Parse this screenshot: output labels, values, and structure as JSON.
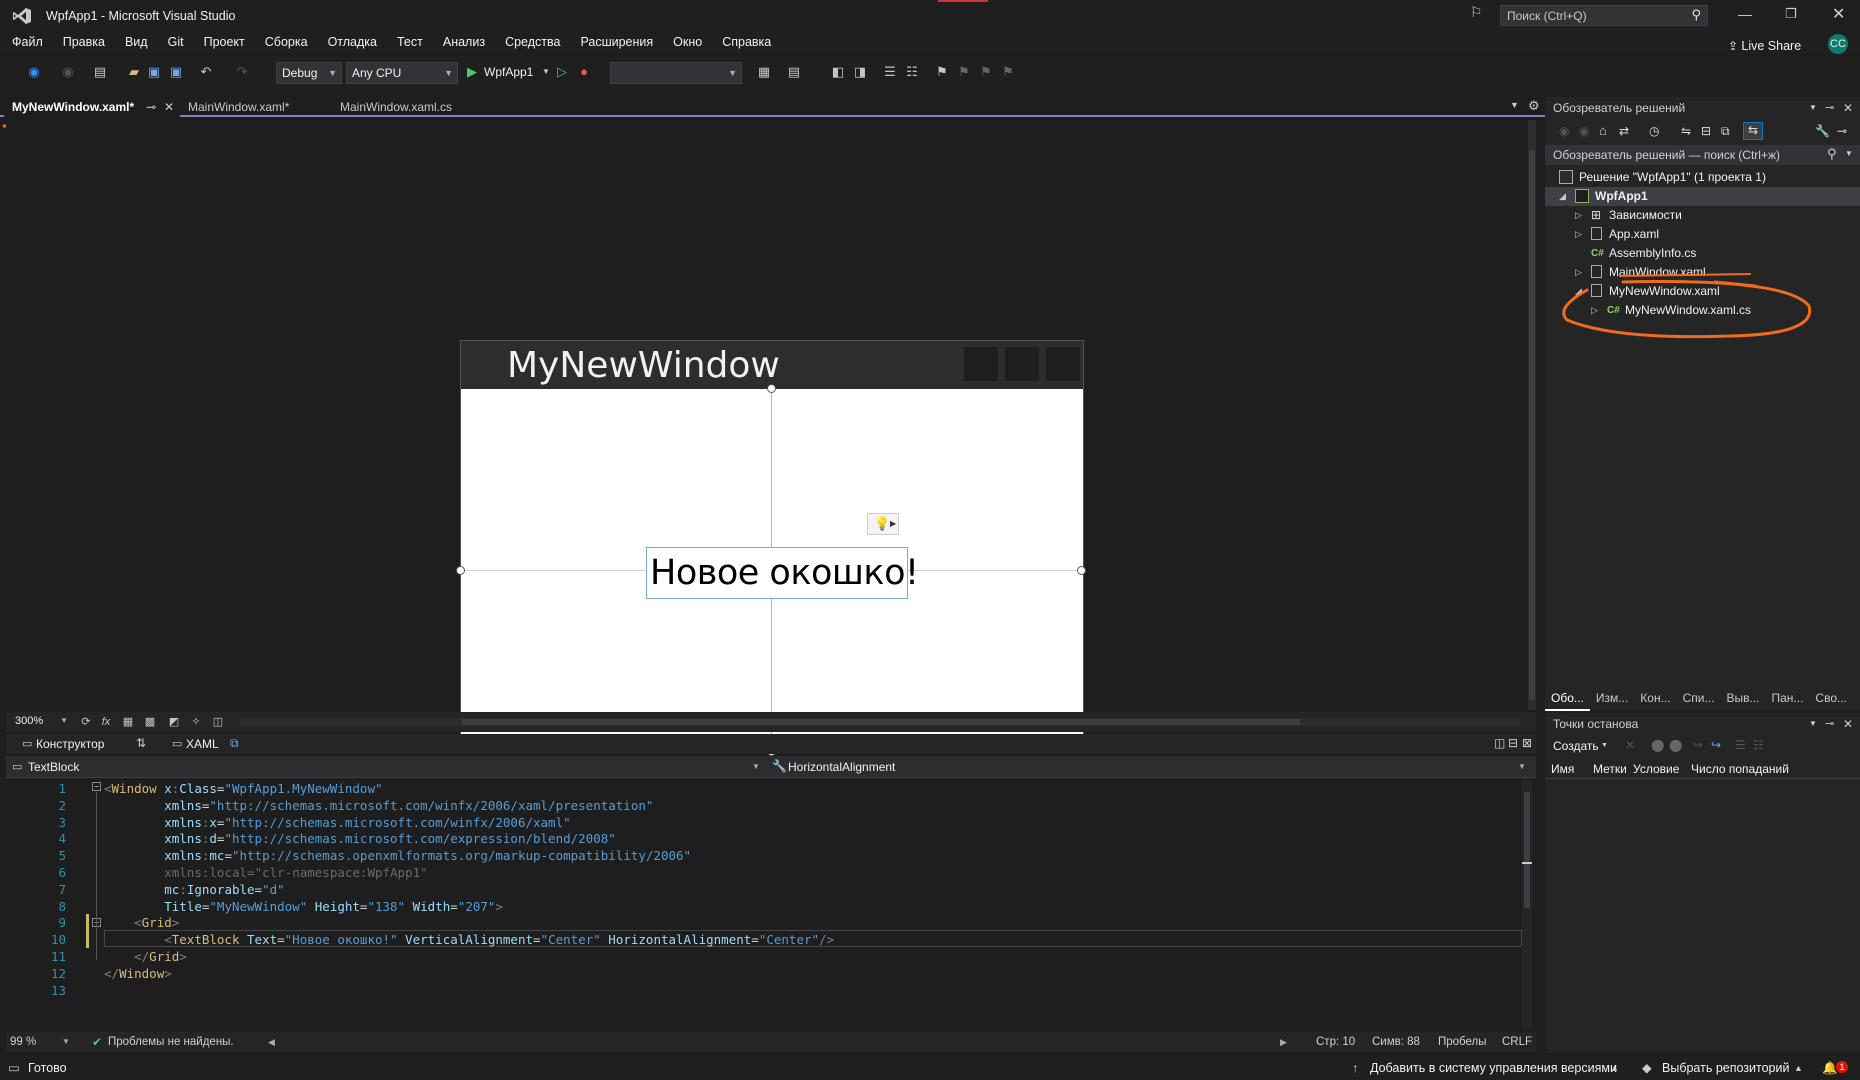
{
  "title": {
    "app": "WpfApp1 - Microsoft Visual Studio",
    "search_placeholder": "Поиск (Ctrl+Q)",
    "live_share": "Live Share",
    "avatar": "CC"
  },
  "menu": [
    "Файл",
    "Правка",
    "Вид",
    "Git",
    "Проект",
    "Сборка",
    "Отладка",
    "Тест",
    "Анализ",
    "Средства",
    "Расширения",
    "Окно",
    "Справка"
  ],
  "toolbar": {
    "config": "Debug",
    "platform": "Any CPU",
    "run_target": "WpfApp1"
  },
  "tabs": [
    {
      "label": "MyNewWindow.xaml*",
      "active": true
    },
    {
      "label": "MainWindow.xaml*",
      "active": false
    },
    {
      "label": "MainWindow.xaml.cs",
      "active": false
    }
  ],
  "designer": {
    "window_title": "MyNewWindow",
    "textblock_text": "Новое окошко!",
    "zoom": "300%"
  },
  "view_tabs": {
    "designer": "Конструктор",
    "xaml": "XAML"
  },
  "xaml_nav": {
    "element": "TextBlock",
    "property": "HorizontalAlignment"
  },
  "code_lines": [
    {
      "n": "1",
      "html": "<span class='pun'>&lt;</span><span class='el'>Window</span> <span class='attr'>x</span><span class='pun'>:</span><span class='attr'>Class</span><span class='tx'>=</span><span class='str'>\"WpfApp1.MyNewWindow\"</span>"
    },
    {
      "n": "2",
      "html": "        <span class='attr'>xmlns</span><span class='tx'>=</span><span class='str'>\"http://schemas.microsoft.com/winfx/2006/xaml/presentation\"</span>"
    },
    {
      "n": "3",
      "html": "        <span class='attr'>xmlns</span><span class='pun'>:</span><span class='attr'>x</span><span class='tx'>=</span><span class='str'>\"http://schemas.microsoft.com/winfx/2006/xaml\"</span>"
    },
    {
      "n": "4",
      "html": "        <span class='attr'>xmlns</span><span class='pun'>:</span><span class='attr'>d</span><span class='tx'>=</span><span class='str'>\"http://schemas.microsoft.com/expression/blend/2008\"</span>"
    },
    {
      "n": "5",
      "html": "        <span class='attr'>xmlns</span><span class='pun'>:</span><span class='attr'>mc</span><span class='tx'>=</span><span class='str'>\"http://schemas.openxmlformats.org/markup-compatibility/2006\"</span>"
    },
    {
      "n": "6",
      "html": "        <span class='dim'>xmlns</span><span class='dim'>:</span><span class='dim'>local</span><span class='dim'>=</span><span class='dim'>\"clr-namespace:WpfApp1\"</span>"
    },
    {
      "n": "7",
      "html": "        <span class='attr'>mc</span><span class='pun'>:</span><span class='attr'>Ignorable</span><span class='tx'>=</span><span class='str'>\"d\"</span>"
    },
    {
      "n": "8",
      "html": "        <span class='attr'>Title</span><span class='tx'>=</span><span class='str'>\"MyNewWindow\"</span> <span class='attr'>Height</span><span class='tx'>=</span><span class='str'>\"138\"</span> <span class='attr'>Width</span><span class='tx'>=</span><span class='str'>\"207\"</span><span class='pun'>&gt;</span>"
    },
    {
      "n": "9",
      "html": "    <span class='pun'>&lt;</span><span class='el'>Grid</span><span class='pun'>&gt;</span>"
    },
    {
      "n": "10",
      "html": "        <span class='pun'>&lt;</span><span class='el'>TextBlock</span> <span class='attr'>Text</span><span class='tx'>=</span><span class='str'>\"Новое окошко!\"</span> <span class='attr'>VerticalAlignment</span><span class='tx'>=</span><span class='str'>\"Center\"</span> <span class='attr'>HorizontalAlignment</span><span class='tx'>=</span><span class='str'>\"Center\"</span><span class='pun'>/&gt;</span>"
    },
    {
      "n": "11",
      "html": "    <span class='pun'>&lt;/</span><span class='el'>Grid</span><span class='pun'>&gt;</span>"
    },
    {
      "n": "12",
      "html": "<span class='pun'>&lt;/</span><span class='el'>Window</span><span class='pun'>&gt;</span>"
    },
    {
      "n": "13",
      "html": ""
    }
  ],
  "editor_status": {
    "zoom": "99 %",
    "issues": "Проблемы не найдены.",
    "line": "Стр: 10",
    "col": "Симв: 88",
    "whitespace": "Пробелы",
    "eol": "CRLF"
  },
  "status": {
    "ready": "Готово",
    "vcs": "Добавить в систему управления версиями",
    "repo": "Выбрать репозиторий",
    "notifications": "1"
  },
  "solution_explorer": {
    "title": "Обозреватель решений",
    "search": "Обозреватель решений — поиск (Ctrl+ж)",
    "solution": "Решение \"WpfApp1\" (1 проекта 1)",
    "project": "WpfApp1",
    "items": [
      {
        "label": "Зависимости",
        "icon": "dependencies-icon",
        "expander": true
      },
      {
        "label": "App.xaml",
        "icon": "xaml-file-icon",
        "expander": true
      },
      {
        "label": "AssemblyInfo.cs",
        "icon": "csharp-file-icon",
        "expander": false
      },
      {
        "label": "MainWindow.xaml",
        "icon": "xaml-file-icon",
        "expander": true
      },
      {
        "label": "MyNewWindow.xaml",
        "icon": "xaml-file-icon",
        "expander": true,
        "expanded": true
      },
      {
        "label": "MyNewWindow.xaml.cs",
        "icon": "csharp-file-icon",
        "expander": true,
        "child": true
      }
    ],
    "bottom_tabs": [
      "Обо...",
      "Изм...",
      "Кон...",
      "Спи...",
      "Выв...",
      "Пан...",
      "Сво..."
    ]
  },
  "breakpoints": {
    "title": "Точки останова",
    "create": "Создать",
    "columns": [
      "Имя",
      "Метки",
      "Условие",
      "Число попаданий"
    ]
  }
}
